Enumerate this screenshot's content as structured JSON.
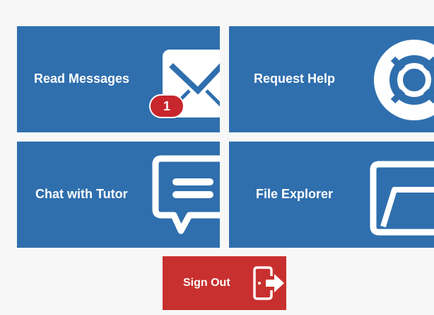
{
  "tiles": {
    "read_messages": {
      "label": "Read Messages",
      "badge": "1",
      "icon": "envelope-icon"
    },
    "request_help": {
      "label": "Request Help",
      "icon": "lifebuoy-icon"
    },
    "chat_with_tutor": {
      "label": "Chat with Tutor",
      "icon": "chat-bubble-icon"
    },
    "file_explorer": {
      "label": "File Explorer",
      "icon": "folder-icon"
    }
  },
  "sign_out": {
    "label": "Sign Out",
    "icon": "exit-door-icon"
  },
  "colors": {
    "tile_blue": "#2f6fae",
    "badge_red": "#c8262d",
    "sign_out_red": "#c8302f",
    "background": "#f7f7f7"
  }
}
